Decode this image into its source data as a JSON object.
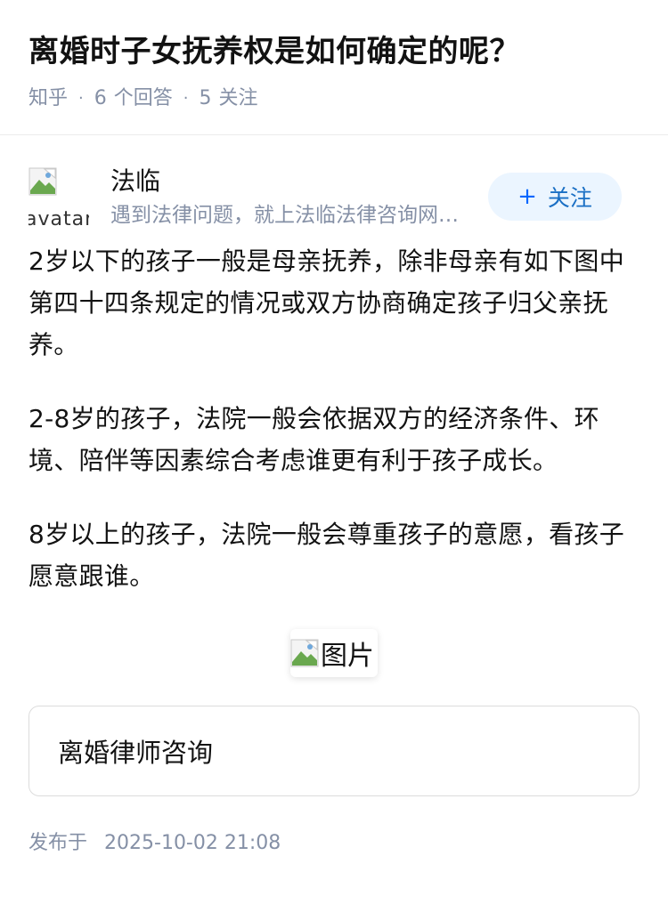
{
  "question": {
    "title": "离婚时子女抚养权是如何确定的呢？",
    "source": "知乎",
    "separator": "·",
    "answers_count": "6",
    "answers_label": "个回答",
    "follows_count": "5",
    "follows_label": "关注"
  },
  "author": {
    "avatar_alt": "avatar",
    "name": "法临",
    "bio": "遇到法律问题，就上法临法律咨询网，快速解答您的法律问题",
    "follow_plus": "+",
    "follow_label": "关注"
  },
  "answer": {
    "paragraphs": [
      "2岁以下的孩子一般是母亲抚养，除非母亲有如下图中第四十四条规定的情况或双方协商确定孩子归父亲抚养。",
      "2-8岁的孩子，法院一般会依据双方的经济条件、环境、陪伴等因素综合考虑谁更有利于孩子成长。",
      "8岁以上的孩子，法院一般会尊重孩子的意愿，看孩子愿意跟谁。"
    ],
    "image_alt": "图片",
    "consult_card": "离婚律师咨询"
  },
  "footer": {
    "published_label": "发布于",
    "published_date": "2025-10-02 21:08"
  },
  "colors": {
    "meta_gray": "#8590a6",
    "follow_bg": "#ebf5ff",
    "follow_text": "#1a6fc4",
    "text": "#121212"
  }
}
